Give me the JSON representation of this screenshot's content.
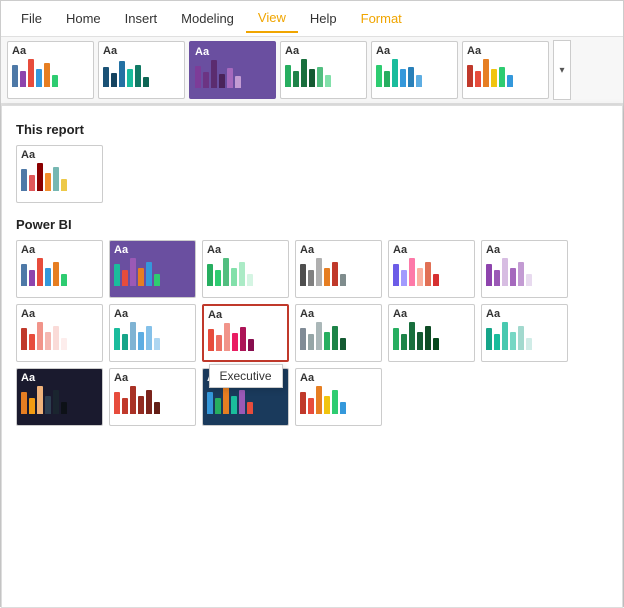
{
  "menubar": {
    "items": [
      {
        "label": "File",
        "active": false
      },
      {
        "label": "Home",
        "active": false
      },
      {
        "label": "Insert",
        "active": false
      },
      {
        "label": "Modeling",
        "active": false
      },
      {
        "label": "View",
        "active": true
      },
      {
        "label": "Help",
        "active": false
      },
      {
        "label": "Format",
        "active": false,
        "highlight": true
      }
    ]
  },
  "theme_bar": {
    "themes": [
      {
        "id": "tb1",
        "aa": "Aa",
        "bars": [
          {
            "h": 22,
            "c": "#4e79a7"
          },
          {
            "h": 16,
            "c": "#8e44ad"
          },
          {
            "h": 28,
            "c": "#e74c3c"
          },
          {
            "h": 18,
            "c": "#3498db"
          },
          {
            "h": 24,
            "c": "#e67e22"
          },
          {
            "h": 12,
            "c": "#2ecc71"
          }
        ],
        "bg": "#fff",
        "selected": false
      },
      {
        "id": "tb2",
        "aa": "Aa",
        "bars": [
          {
            "h": 20,
            "c": "#1a5276"
          },
          {
            "h": 14,
            "c": "#154360"
          },
          {
            "h": 26,
            "c": "#2471a3"
          },
          {
            "h": 18,
            "c": "#1abc9c"
          },
          {
            "h": 22,
            "c": "#117a65"
          },
          {
            "h": 10,
            "c": "#0e6655"
          }
        ],
        "bg": "#fff",
        "selected": false
      },
      {
        "id": "tb3",
        "aa": "Aa",
        "bars": [
          {
            "h": 22,
            "c": "#7d3c98"
          },
          {
            "h": 16,
            "c": "#6c3483"
          },
          {
            "h": 28,
            "c": "#5b2c6f"
          },
          {
            "h": 14,
            "c": "#4a235a"
          },
          {
            "h": 20,
            "c": "#a569bd"
          },
          {
            "h": 12,
            "c": "#c39bd3"
          }
        ],
        "bg": "#6a4fa0",
        "selected": true
      },
      {
        "id": "tb4",
        "aa": "Aa",
        "bars": [
          {
            "h": 22,
            "c": "#27ae60"
          },
          {
            "h": 16,
            "c": "#1e8449"
          },
          {
            "h": 28,
            "c": "#196f3d"
          },
          {
            "h": 18,
            "c": "#145a32"
          },
          {
            "h": 20,
            "c": "#52be80"
          },
          {
            "h": 12,
            "c": "#82e0aa"
          }
        ],
        "bg": "#fff",
        "selected": false
      },
      {
        "id": "tb5",
        "aa": "Aa",
        "bars": [
          {
            "h": 22,
            "c": "#2ecc71"
          },
          {
            "h": 16,
            "c": "#27ae60"
          },
          {
            "h": 28,
            "c": "#1abc9c"
          },
          {
            "h": 18,
            "c": "#3498db"
          },
          {
            "h": 20,
            "c": "#2980b9"
          },
          {
            "h": 12,
            "c": "#5dade2"
          }
        ],
        "bg": "#fff",
        "selected": false
      },
      {
        "id": "tb6",
        "aa": "Aa",
        "bars": [
          {
            "h": 22,
            "c": "#c0392b"
          },
          {
            "h": 16,
            "c": "#e74c3c"
          },
          {
            "h": 28,
            "c": "#e67e22"
          },
          {
            "h": 18,
            "c": "#f1c40f"
          },
          {
            "h": 20,
            "c": "#2ecc71"
          },
          {
            "h": 12,
            "c": "#3498db"
          }
        ],
        "bg": "#fff",
        "selected": false
      }
    ],
    "chevron": "▾"
  },
  "sections": [
    {
      "label": "This report",
      "themes": [
        {
          "id": "r1",
          "aa": "Aa",
          "bars": [
            {
              "h": 22,
              "c": "#4e79a7"
            },
            {
              "h": 16,
              "c": "#e15759"
            },
            {
              "h": 28,
              "c": "#8b0000"
            },
            {
              "h": 18,
              "c": "#f28e2b"
            },
            {
              "h": 24,
              "c": "#76b7b2"
            },
            {
              "h": 12,
              "c": "#edc948"
            }
          ],
          "bg": "#fff",
          "selected": false,
          "highlighted": false
        }
      ]
    },
    {
      "label": "Power BI",
      "themes": [
        {
          "id": "p1",
          "aa": "Aa",
          "bars": [
            {
              "h": 22,
              "c": "#4e79a7"
            },
            {
              "h": 16,
              "c": "#8e44ad"
            },
            {
              "h": 28,
              "c": "#e74c3c"
            },
            {
              "h": 18,
              "c": "#3498db"
            },
            {
              "h": 24,
              "c": "#e67e22"
            },
            {
              "h": 12,
              "c": "#2ecc71"
            }
          ],
          "bg": "#fff",
          "selected": false,
          "highlighted": false
        },
        {
          "id": "p2",
          "aa": "Aa",
          "bars": [
            {
              "h": 22,
              "c": "#1abc9c"
            },
            {
              "h": 16,
              "c": "#e74c3c"
            },
            {
              "h": 28,
              "c": "#9b59b6"
            },
            {
              "h": 18,
              "c": "#e67e22"
            },
            {
              "h": 24,
              "c": "#3498db"
            },
            {
              "h": 12,
              "c": "#2ecc71"
            }
          ],
          "bg": "#6a4fa0",
          "selected": false,
          "highlighted": false
        },
        {
          "id": "p3",
          "aa": "Aa",
          "bars": [
            {
              "h": 22,
              "c": "#27ae60"
            },
            {
              "h": 16,
              "c": "#2ecc71"
            },
            {
              "h": 28,
              "c": "#52be80"
            },
            {
              "h": 18,
              "c": "#82e0aa"
            },
            {
              "h": 24,
              "c": "#abebc6"
            },
            {
              "h": 12,
              "c": "#d5f5e3"
            }
          ],
          "bg": "#fff",
          "selected": false,
          "highlighted": false
        },
        {
          "id": "p4",
          "aa": "Aa",
          "bars": [
            {
              "h": 22,
              "c": "#4e4e4e"
            },
            {
              "h": 16,
              "c": "#808080"
            },
            {
              "h": 28,
              "c": "#b0b0b0"
            },
            {
              "h": 18,
              "c": "#e67e22"
            },
            {
              "h": 24,
              "c": "#c0392b"
            },
            {
              "h": 12,
              "c": "#7f8c8d"
            }
          ],
          "bg": "#fff",
          "selected": false,
          "highlighted": false
        },
        {
          "id": "p5",
          "aa": "Aa",
          "bars": [
            {
              "h": 22,
              "c": "#6c5ce7"
            },
            {
              "h": 16,
              "c": "#a29bfe"
            },
            {
              "h": 28,
              "c": "#fd79a8"
            },
            {
              "h": 18,
              "c": "#fab1a0"
            },
            {
              "h": 24,
              "c": "#e17055"
            },
            {
              "h": 12,
              "c": "#d63031"
            }
          ],
          "bg": "#fff",
          "selected": false,
          "highlighted": false
        },
        {
          "id": "p6",
          "aa": "Aa",
          "bars": [
            {
              "h": 22,
              "c": "#8e44ad"
            },
            {
              "h": 16,
              "c": "#9b59b6"
            },
            {
              "h": 28,
              "c": "#d7bde2"
            },
            {
              "h": 18,
              "c": "#a569bd"
            },
            {
              "h": 24,
              "c": "#c39bd3"
            },
            {
              "h": 12,
              "c": "#e8daef"
            }
          ],
          "bg": "#fff",
          "selected": false,
          "highlighted": false
        },
        {
          "id": "p7",
          "aa": "Aa",
          "bars": [
            {
              "h": 22,
              "c": "#c0392b"
            },
            {
              "h": 16,
              "c": "#e74c3c"
            },
            {
              "h": 28,
              "c": "#f1948a"
            },
            {
              "h": 18,
              "c": "#f5b7b1"
            },
            {
              "h": 24,
              "c": "#fadbd8"
            },
            {
              "h": 12,
              "c": "#fdedec"
            }
          ],
          "bg": "#fff",
          "selected": false,
          "highlighted": false
        },
        {
          "id": "p8",
          "aa": "Aa",
          "bars": [
            {
              "h": 22,
              "c": "#1abc9c"
            },
            {
              "h": 16,
              "c": "#17a589"
            },
            {
              "h": 28,
              "c": "#7fb3d3"
            },
            {
              "h": 18,
              "c": "#5dade2"
            },
            {
              "h": 24,
              "c": "#85c1e9"
            },
            {
              "h": 12,
              "c": "#aed6f1"
            }
          ],
          "bg": "#fff",
          "selected": false,
          "highlighted": false
        },
        {
          "id": "p9",
          "aa": "Aa",
          "bars": [
            {
              "h": 22,
              "c": "#e74c3c"
            },
            {
              "h": 16,
              "c": "#ec7063"
            },
            {
              "h": 28,
              "c": "#f1948a"
            },
            {
              "h": 18,
              "c": "#e91e63"
            },
            {
              "h": 24,
              "c": "#ad1457"
            },
            {
              "h": 12,
              "c": "#880e4f"
            }
          ],
          "bg": "#fff",
          "selected": false,
          "highlighted": true,
          "tooltip": "Executive"
        },
        {
          "id": "p10",
          "aa": "Aa",
          "bars": [
            {
              "h": 22,
              "c": "#808b96"
            },
            {
              "h": 16,
              "c": "#95a5a6"
            },
            {
              "h": 28,
              "c": "#aab7b8"
            },
            {
              "h": 18,
              "c": "#27ae60"
            },
            {
              "h": 24,
              "c": "#1e8449"
            },
            {
              "h": 12,
              "c": "#145a32"
            }
          ],
          "bg": "#fff",
          "selected": false,
          "highlighted": false
        },
        {
          "id": "p11",
          "aa": "Aa",
          "bars": [
            {
              "h": 22,
              "c": "#27ae60"
            },
            {
              "h": 16,
              "c": "#1e8449"
            },
            {
              "h": 28,
              "c": "#196f3d"
            },
            {
              "h": 18,
              "c": "#145a32"
            },
            {
              "h": 24,
              "c": "#0e4c25"
            },
            {
              "h": 12,
              "c": "#074a1e"
            }
          ],
          "bg": "#fff",
          "selected": false,
          "highlighted": false
        },
        {
          "id": "p12",
          "aa": "Aa",
          "bars": [
            {
              "h": 22,
              "c": "#17a589"
            },
            {
              "h": 16,
              "c": "#1abc9c"
            },
            {
              "h": 28,
              "c": "#48c9b0"
            },
            {
              "h": 18,
              "c": "#76d7c4"
            },
            {
              "h": 24,
              "c": "#a2d9ce"
            },
            {
              "h": 12,
              "c": "#d0ece7"
            }
          ],
          "bg": "#fff",
          "selected": false,
          "highlighted": false
        },
        {
          "id": "p13",
          "aa": "Aa",
          "bars": [
            {
              "h": 22,
              "c": "#e67e22"
            },
            {
              "h": 16,
              "c": "#f39c12"
            },
            {
              "h": 28,
              "c": "#f0b27a"
            },
            {
              "h": 18,
              "c": "#2c3e50"
            },
            {
              "h": 24,
              "c": "#1a252f"
            },
            {
              "h": 12,
              "c": "#0d1117"
            }
          ],
          "bg": "#1a1a2e",
          "selected": false,
          "highlighted": false
        },
        {
          "id": "p14",
          "aa": "Aa",
          "bars": [
            {
              "h": 22,
              "c": "#e74c3c"
            },
            {
              "h": 16,
              "c": "#c0392b"
            },
            {
              "h": 28,
              "c": "#a93226"
            },
            {
              "h": 18,
              "c": "#922b21"
            },
            {
              "h": 24,
              "c": "#7b241c"
            },
            {
              "h": 12,
              "c": "#641e16"
            }
          ],
          "bg": "#fff",
          "selected": false,
          "highlighted": false
        },
        {
          "id": "p15",
          "aa": "Aa",
          "bars": [
            {
              "h": 22,
              "c": "#3498db"
            },
            {
              "h": 16,
              "c": "#27ae60"
            },
            {
              "h": 28,
              "c": "#e67e22"
            },
            {
              "h": 18,
              "c": "#1abc9c"
            },
            {
              "h": 24,
              "c": "#9b59b6"
            },
            {
              "h": 12,
              "c": "#e74c3c"
            }
          ],
          "bg": "#1a3a5c",
          "selected": false,
          "highlighted": false
        },
        {
          "id": "p16",
          "aa": "Aa",
          "bars": [
            {
              "h": 22,
              "c": "#c0392b"
            },
            {
              "h": 16,
              "c": "#e74c3c"
            },
            {
              "h": 28,
              "c": "#e67e22"
            },
            {
              "h": 18,
              "c": "#f1c40f"
            },
            {
              "h": 24,
              "c": "#2ecc71"
            },
            {
              "h": 12,
              "c": "#3498db"
            }
          ],
          "bg": "#fff",
          "selected": false,
          "highlighted": false
        }
      ]
    }
  ]
}
